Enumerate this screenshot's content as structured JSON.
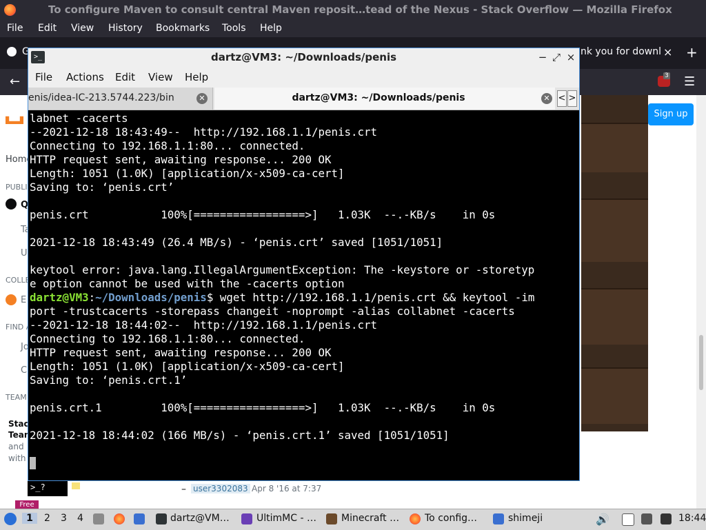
{
  "firefox": {
    "window_title": "To configure Maven to consult central Maven reposit…tead of the Nexus - Stack Overflow — Mozilla Firefox",
    "menu": [
      "File",
      "Edit",
      "View",
      "History",
      "Bookmarks",
      "Tools",
      "Help"
    ],
    "tab_partial_left": "G",
    "tab_partial_right": "nk you for downl",
    "tab_close": "×",
    "new_tab": "+",
    "notif_count": "3"
  },
  "stackoverflow": {
    "left_nav": [
      "Home",
      "PUBLI",
      "Q",
      "Ta",
      "U",
      "COLLE",
      "E",
      "FIND A",
      "Jo",
      "C",
      "TEAM"
    ],
    "teams_promo": [
      "Stac",
      "Tean",
      "and",
      "with"
    ],
    "signup_label": "Sign up",
    "comment_user": "user3302083",
    "comment_dash": "–",
    "comment_date": "Apr 8 '16 at 7:37",
    "free_badge": "Free",
    "mini_terminal": ">_?"
  },
  "terminal": {
    "title": "dartz@VM3: ~/Downloads/penis",
    "menu": [
      "File",
      "Actions",
      "Edit",
      "View",
      "Help"
    ],
    "tabs": [
      {
        "label": "enis/idea-IC-213.5744.223/bin",
        "active": false
      },
      {
        "label": "dartz@VM3: ~/Downloads/penis",
        "active": true
      }
    ],
    "win_buttons": {
      "minimize": "−",
      "maximize": "⤢",
      "close": "×"
    },
    "tab_scroll": {
      "left": "<",
      "right": ">"
    },
    "lines_top": [
      "labnet -cacerts",
      "--2021-12-18 18:43:49--  http://192.168.1.1/penis.crt",
      "Connecting to 192.168.1.1:80... connected.",
      "HTTP request sent, awaiting response... 200 OK",
      "Length: 1051 (1.0K) [application/x-x509-ca-cert]",
      "Saving to: ‘penis.crt’",
      "",
      "penis.crt           100%[=================>]   1.03K  --.-KB/s    in 0s",
      "",
      "2021-12-18 18:43:49 (26.4 MB/s) - ‘penis.crt’ saved [1051/1051]",
      "",
      "keytool error: java.lang.IllegalArgumentException: The -keystore or -storetyp",
      "e option cannot be used with the -cacerts option"
    ],
    "prompt_user": "dartz@VM3",
    "prompt_colon": ":",
    "prompt_path": "~/Downloads/penis",
    "prompt_cmd": "$ wget http://192.168.1.1/penis.crt && keytool -im",
    "lines_bottom": [
      "port -trustcacerts -storepass changeit -noprompt -alias collabnet -cacerts",
      "--2021-12-18 18:44:02--  http://192.168.1.1/penis.crt",
      "Connecting to 192.168.1.1:80... connected.",
      "HTTP request sent, awaiting response... 200 OK",
      "Length: 1051 (1.0K) [application/x-x509-ca-cert]",
      "Saving to: ‘penis.crt.1’",
      "",
      "penis.crt.1         100%[=================>]   1.03K  --.-KB/s    in 0s",
      "",
      "2021-12-18 18:44:02 (166 MB/s) - ‘penis.crt.1’ saved [1051/1051]"
    ]
  },
  "taskbar": {
    "workspaces": [
      "1",
      "2",
      "3",
      "4"
    ],
    "windows": [
      "dartz@VM…",
      "UltimMC - …",
      "Minecraft …",
      "To config…",
      "shimeji"
    ],
    "clock": "18:44"
  }
}
